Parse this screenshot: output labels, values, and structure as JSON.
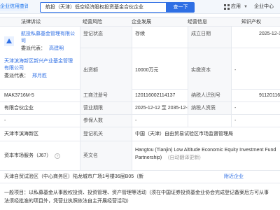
{
  "header": {
    "logo_text": "企业信用查询",
    "search_value": "航投（天津）低空经济股权投资基金合伙企业",
    "search_button": "查一下",
    "app_label": "应用",
    "enterprise_center": "企业中心"
  },
  "columns": {
    "legal_rep": "法律诉讼",
    "operation_status": "经营风险",
    "enterprise_dev": "企业发展",
    "business": "经营信息",
    "ip": "知识产权"
  },
  "partner": {
    "name_line1": "航投私募基金管理有限公",
    "name_line2": "司",
    "rep_label": "委派代表：",
    "rep_name": "高建明",
    "partner2_line1": "天津滨海新区新兴产业基金管理",
    "partner2_line2": "有限公司",
    "rep2_label": "委派代表：",
    "rep2_name": "邢月胜"
  },
  "fields": {
    "reg_status_label": "登记状态",
    "reg_status": "存续",
    "est_date_label": "成立日期",
    "est_date": "2025-12-1",
    "capital_label": "出资额",
    "capital": "10000万元",
    "paid_capital_label": "实缴资本",
    "paid_capital": "-",
    "credit_code": "MAK3716M-5",
    "reg_no_label": "工商注册号",
    "reg_no": "120116002114137",
    "taxpayer_no_label": "纳税人识别号",
    "taxpayer_no": "91120116",
    "company_type": "有限合伙企业",
    "term_label": "营业期限",
    "term": "2025-12-12 至 2035-12-11",
    "taxpayer_qual_label": "纳税人资质",
    "taxpayer_qual": "-",
    "blank_a": "-",
    "insured_label": "参保人数",
    "insured": "-",
    "insured_extra": "-",
    "region": "天津市滨海新区",
    "reg_authority_label": "登记机关",
    "reg_authority": "中国（天津）自由贸易试验区市场监督管理局",
    "capital_market": "资本市场服务（J67）",
    "en_name_label": "英文名",
    "en_name_line1": "Hangtou (Tianjin) Low Altitude Economic Equity Investment Fund",
    "en_name_line2": "Partnership)",
    "en_name_note": "(自动翻译更新)",
    "address": "天津自贸试验区（中心商务区）陆龙城市广场1号楼36层B05（新",
    "address_suffix": "附近企业",
    "scope_line1": "一般项目：以私募基金从事股权投资、投资管理、资产管理等活动（须在中国证券投资基金业协会完成登记备案后方可从事",
    "scope_line2": "法须经批准的项目外，凭营业执照依法自主开展经营活动）"
  }
}
